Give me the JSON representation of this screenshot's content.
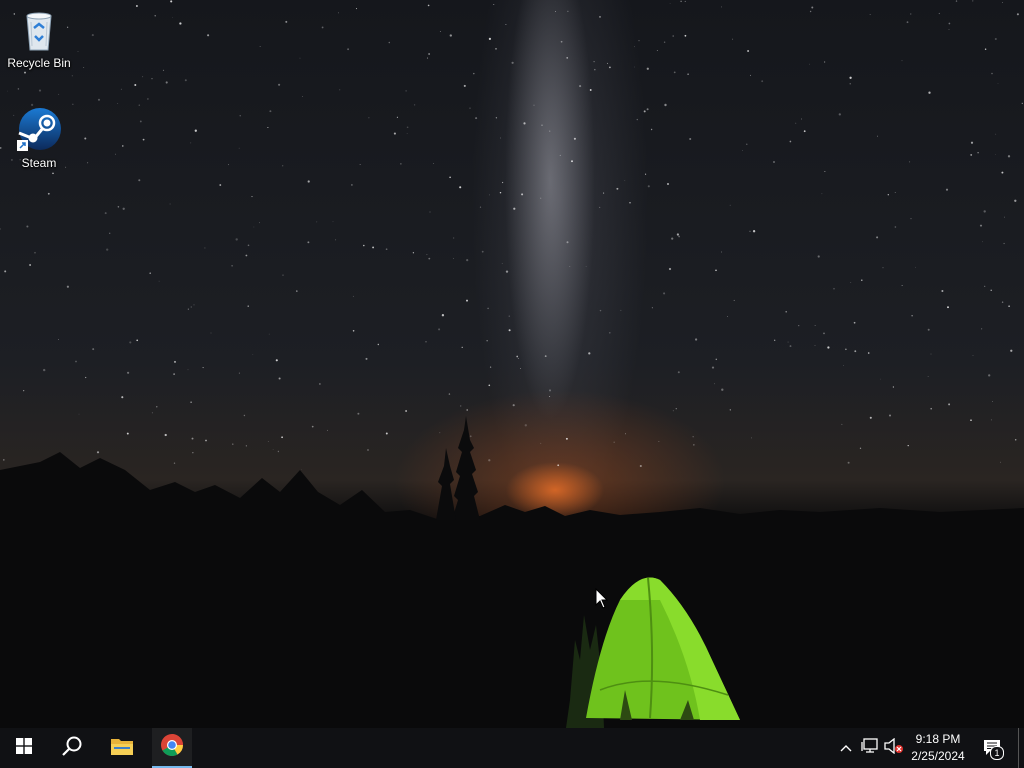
{
  "desktop": {
    "icons": [
      {
        "label": "Recycle Bin",
        "icon": "recycle-bin-icon"
      },
      {
        "label": "Steam",
        "icon": "steam-icon"
      }
    ]
  },
  "taskbar": {
    "start": "windows-start-icon",
    "search": "search-icon",
    "pinned": [
      {
        "name": "File Explorer",
        "icon": "folder-icon",
        "active": false
      },
      {
        "name": "Google Chrome",
        "icon": "chrome-icon",
        "active": true
      }
    ],
    "tray": {
      "icons": [
        "chevron-up-icon",
        "network-icon",
        "volume-muted-icon"
      ],
      "time": "9:18 PM",
      "date": "2/25/2024",
      "notifications_count": "1"
    }
  },
  "colors": {
    "taskbar_bg": "#101114",
    "active_indicator": "#76b9ed",
    "tent_green": "#7ed321"
  }
}
